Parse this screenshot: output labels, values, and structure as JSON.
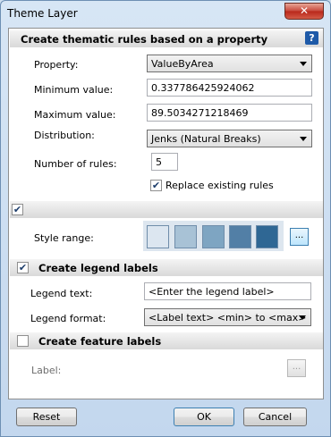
{
  "window": {
    "title": "Theme Layer",
    "close_label": "✕"
  },
  "thematic": {
    "header": "Create thematic rules based on a property",
    "help_label": "?",
    "property_label": "Property:",
    "property_value": "ValueByArea",
    "min_label": "Minimum value:",
    "min_value": "0.337786425924062",
    "max_label": "Maximum value:",
    "max_value": "89.5034271218469",
    "distribution_label": "Distribution:",
    "distribution_value": "Jenks (Natural Breaks)",
    "rules_label": "Number of rules:",
    "rules_value": "5",
    "replace_label": "Replace existing rules",
    "replace_checked": true
  },
  "style": {
    "section_checked": true,
    "range_label": "Style range:",
    "swatch_colors": [
      "#dce6f0",
      "#a8c2d6",
      "#7ea5c2",
      "#527fa6",
      "#2f6794"
    ],
    "more_label": "..."
  },
  "legend": {
    "header": "Create legend labels",
    "checked": true,
    "text_label": "Legend text:",
    "text_value": "<Enter the legend label>",
    "format_label": "Legend format:",
    "format_value": "<Label text> <min> to <max>"
  },
  "feature": {
    "header": "Create feature labels",
    "checked": false,
    "label_label": "Label:",
    "more_label": "..."
  },
  "buttons": {
    "reset": "Reset",
    "ok": "OK",
    "cancel": "Cancel"
  }
}
